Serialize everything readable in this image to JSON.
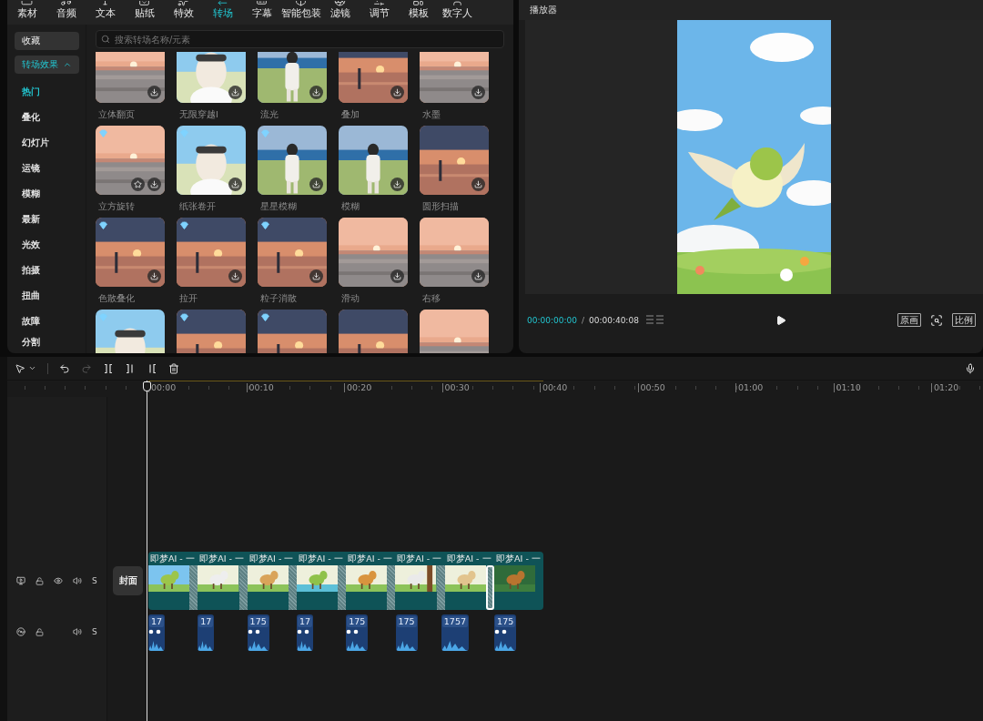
{
  "media_tabs": [
    {
      "label": "素材",
      "selected": false
    },
    {
      "label": "音频",
      "selected": false
    },
    {
      "label": "文本",
      "selected": false
    },
    {
      "label": "贴纸",
      "selected": false
    },
    {
      "label": "特效",
      "selected": false
    },
    {
      "label": "转场",
      "selected": true
    },
    {
      "label": "字幕",
      "selected": false
    },
    {
      "label": "智能包装",
      "selected": false
    },
    {
      "label": "滤镜",
      "selected": false
    },
    {
      "label": "调节",
      "selected": false
    },
    {
      "label": "模板",
      "selected": false
    },
    {
      "label": "数字人",
      "selected": false
    }
  ],
  "sidebar": {
    "favorites": "收藏",
    "group": {
      "label": "转场效果",
      "expanded": true
    },
    "items": [
      {
        "label": "热门",
        "selected": true
      },
      {
        "label": "叠化",
        "selected": false
      },
      {
        "label": "幻灯片",
        "selected": false
      },
      {
        "label": "运镜",
        "selected": false
      },
      {
        "label": "模糊",
        "selected": false
      },
      {
        "label": "最新",
        "selected": false
      },
      {
        "label": "光效",
        "selected": false
      },
      {
        "label": "拍摄",
        "selected": false
      },
      {
        "label": "扭曲",
        "selected": false
      },
      {
        "label": "故障",
        "selected": false
      },
      {
        "label": "分割",
        "selected": false
      }
    ]
  },
  "search": {
    "placeholder": "搜索转场名称/元素"
  },
  "effects": [
    {
      "label": "立体翻页",
      "premium": false,
      "hovered": false
    },
    {
      "label": "无限穿越Ⅰ",
      "premium": false,
      "hovered": false
    },
    {
      "label": "流光",
      "premium": false,
      "hovered": false
    },
    {
      "label": "叠加",
      "premium": false,
      "hovered": false
    },
    {
      "label": "水墨",
      "premium": false,
      "hovered": false
    },
    {
      "label": "立方旋转",
      "premium": true,
      "hovered": true
    },
    {
      "label": "纸张卷开",
      "premium": true,
      "hovered": false
    },
    {
      "label": "星星模糊",
      "premium": true,
      "hovered": false
    },
    {
      "label": "模糊",
      "premium": false,
      "hovered": false
    },
    {
      "label": "圆形扫描",
      "premium": false,
      "hovered": false
    },
    {
      "label": "色散叠化",
      "premium": true,
      "hovered": false
    },
    {
      "label": "拉开",
      "premium": true,
      "hovered": false
    },
    {
      "label": "粒子消散",
      "premium": true,
      "hovered": false
    },
    {
      "label": "滑动",
      "premium": false,
      "hovered": false
    },
    {
      "label": "右移",
      "premium": false,
      "hovered": false
    },
    {
      "premium": true,
      "hovered": false
    },
    {
      "premium": true,
      "hovered": false
    },
    {
      "premium": true,
      "hovered": false
    },
    {
      "premium": false,
      "hovered": false
    },
    {
      "premium": false,
      "hovered": false
    }
  ],
  "player": {
    "title": "播放器",
    "current_time": "00:00:00:00",
    "separator": "/",
    "total_time": "00:00:40:08",
    "original_button": "原画",
    "ratio_button": "比例"
  },
  "ruler": [
    "00:00",
    "00:10",
    "00:20",
    "00:30",
    "00:40",
    "00:50",
    "01:00",
    "01:10",
    "01:20"
  ],
  "cover_button": "封面",
  "video_track": {
    "locked": false,
    "hidden": false,
    "muted": false,
    "solo_label": "S"
  },
  "audio_track": {
    "locked": false,
    "muted": false,
    "solo_label": "S"
  },
  "video_clips": [
    {
      "label": "即梦AI - 一"
    },
    {
      "label": "即梦AI - 一"
    },
    {
      "label": "即梦AI - 一"
    },
    {
      "label": "即梦AI - 一"
    },
    {
      "label": "即梦AI - 一"
    },
    {
      "label": "即梦AI - 一"
    },
    {
      "label": "即梦AI - 一"
    },
    {
      "label": "即梦AI - 一"
    }
  ],
  "transitions": [
    {
      "selected": false
    },
    {
      "selected": false
    },
    {
      "selected": false
    },
    {
      "selected": false
    },
    {
      "selected": false
    },
    {
      "selected": false
    },
    {
      "selected": true
    }
  ],
  "audio_clips": [
    {
      "label": "17",
      "markers": true
    },
    {
      "label": "17",
      "markers": false
    },
    {
      "label": "175",
      "markers": true
    },
    {
      "label": "17",
      "markers": true
    },
    {
      "label": "175",
      "markers": true
    },
    {
      "label": "175",
      "markers": false
    },
    {
      "label": "1757",
      "markers": false
    },
    {
      "label": "175",
      "markers": true
    }
  ]
}
